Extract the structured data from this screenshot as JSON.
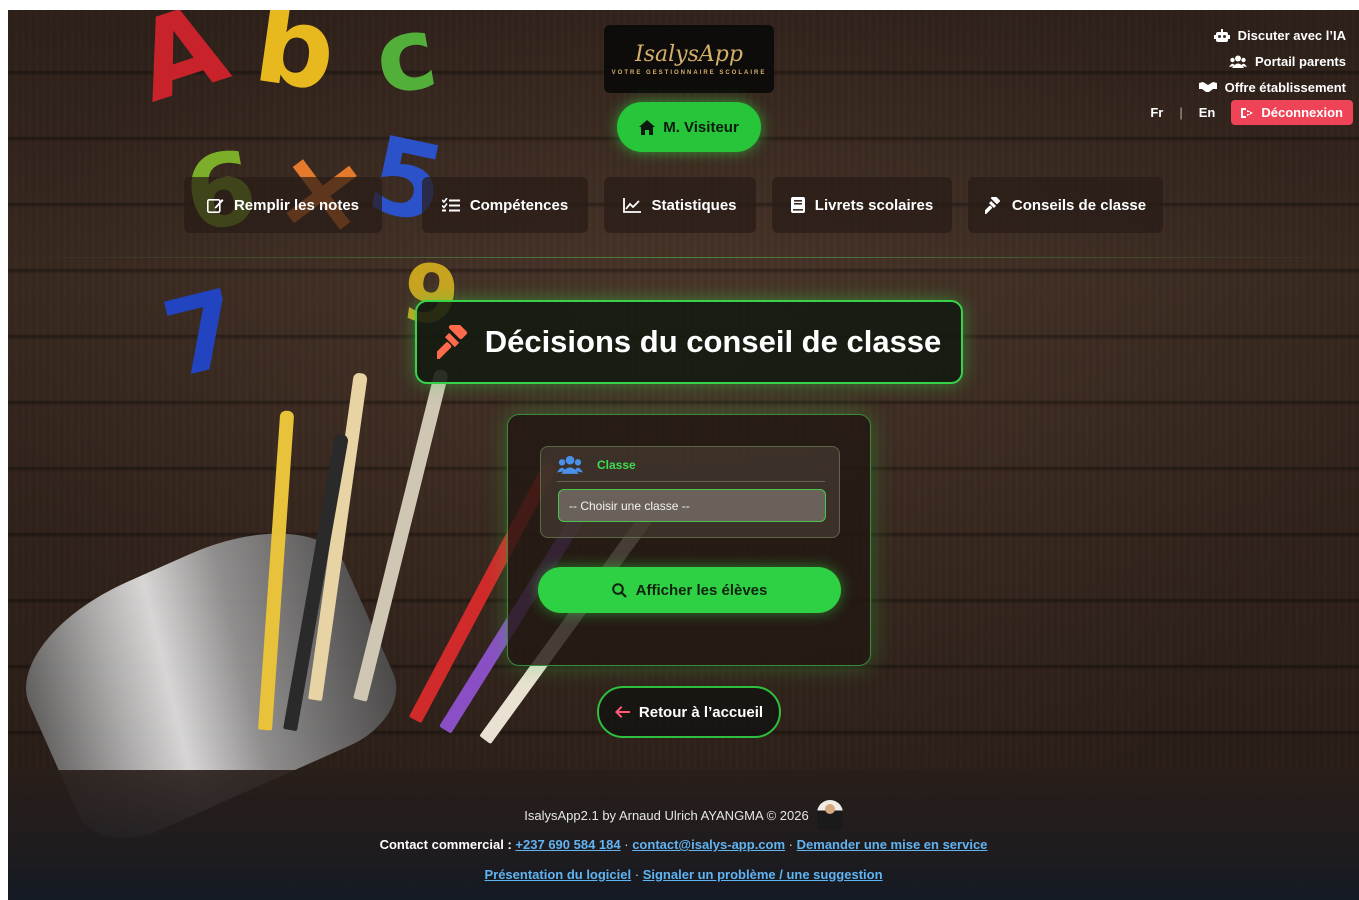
{
  "logo": {
    "name": "IsalysApp",
    "tagline": "VOTRE GESTIONNAIRE SCOLAIRE"
  },
  "header": {
    "visitor_label": "M. Visiteur",
    "links": [
      {
        "label": "Discuter avec l’IA",
        "icon": "robot-icon"
      },
      {
        "label": "Portail parents",
        "icon": "users-icon"
      },
      {
        "label": "Offre établissement",
        "icon": "handshake-icon"
      }
    ],
    "lang_fr": "Fr",
    "lang_sep": "|",
    "lang_en": "En",
    "logout_label": "Déconnexion"
  },
  "nav": {
    "items": [
      {
        "label": "Remplir les notes",
        "icon": "edit-icon"
      },
      {
        "label": "Compétences",
        "icon": "list-check-icon"
      },
      {
        "label": "Statistiques",
        "icon": "chart-line-icon"
      },
      {
        "label": "Livrets scolaires",
        "icon": "book-icon"
      },
      {
        "label": "Conseils de classe",
        "icon": "gavel-icon"
      }
    ]
  },
  "main": {
    "title": "Décisions du conseil de classe",
    "title_icon": "gavel-icon",
    "field_label": "Classe",
    "select_placeholder": "-- Choisir une classe --",
    "show_button_label": "Afficher les élèves",
    "back_button_label": "Retour à l’accueil"
  },
  "footer": {
    "credit": "IsalysApp2.1 by Arnaud Ulrich AYANGMA © 2026",
    "contact_prefix": "Contact commercial :",
    "phone": "+237 690 584 184",
    "email": "contact@isalys-app.com",
    "service_link": "Demander une mise en service",
    "dot": "·",
    "presentation_link": "Présentation du logiciel",
    "report_link": "Signaler un problème / une suggestion"
  },
  "colors": {
    "accent_green": "#2ed143",
    "logout_red": "#ef4358",
    "link_blue": "#61b4f2"
  }
}
